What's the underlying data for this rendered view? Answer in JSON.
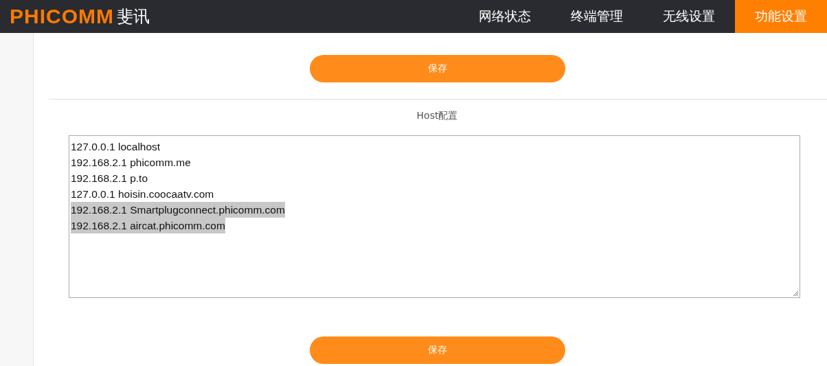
{
  "header": {
    "logo": {
      "brand": "PHICOMM",
      "name": "斐讯"
    },
    "nav": [
      {
        "label": "网络状态",
        "selected": false
      },
      {
        "label": "终端管理",
        "selected": false
      },
      {
        "label": "无线设置",
        "selected": false
      },
      {
        "label": "功能设置",
        "selected": true
      }
    ]
  },
  "top_button": "保存",
  "section_title": "Host配置",
  "hosts_field": {
    "lines": [
      {
        "text": "127.0.0.1 localhost",
        "selected": false
      },
      {
        "text": "192.168.2.1 phicomm.me",
        "selected": false
      },
      {
        "text": "192.168.2.1 p.to",
        "selected": false
      },
      {
        "text": "127.0.0.1 hoisin.coocaatv.com",
        "selected": false
      },
      {
        "text": "192.168.2.1 Smartplugconnect.phicomm.com",
        "selected": true
      },
      {
        "text": "192.168.2.1 aircat.phicomm.com",
        "selected": true
      }
    ]
  },
  "bottom_button": "保存"
}
